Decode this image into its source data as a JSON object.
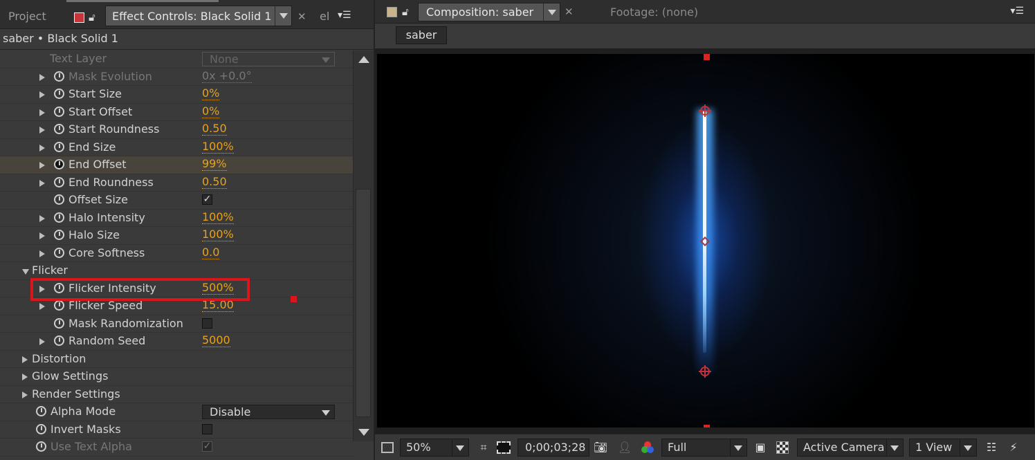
{
  "left_panel": {
    "tab_project": "Project",
    "tab_effect_controls": "Effect Controls: Black Solid 1",
    "tab_overflow": "el",
    "breadcrumb": "saber • Black Solid 1",
    "rows": [
      {
        "name": "Text Layer",
        "type": "dropdown",
        "value": "None",
        "dim": true,
        "indent": 72
      },
      {
        "name": "Mask Evolution",
        "type": "value",
        "value": "0x +0.0°",
        "dim": true,
        "twirl": true,
        "stopwatch": true
      },
      {
        "name": "Start Size",
        "type": "value",
        "value": "0%",
        "twirl": true,
        "stopwatch": true
      },
      {
        "name": "Start Offset",
        "type": "value",
        "value": "0%",
        "twirl": true,
        "stopwatch": true
      },
      {
        "name": "Start Roundness",
        "type": "value",
        "value": "0.50",
        "twirl": true,
        "stopwatch": true
      },
      {
        "name": "End Size",
        "type": "value",
        "value": "100%",
        "twirl": true,
        "stopwatch": true
      },
      {
        "name": "End Offset",
        "type": "value",
        "value": "99%",
        "twirl": true,
        "stopwatch": true,
        "selected": true,
        "active": true
      },
      {
        "name": "End Roundness",
        "type": "value",
        "value": "0.50",
        "twirl": true,
        "stopwatch": true
      },
      {
        "name": "Offset Size",
        "type": "checkbox",
        "checked": true,
        "stopwatch": true
      },
      {
        "name": "Halo Intensity",
        "type": "value",
        "value": "100%",
        "twirl": true,
        "stopwatch": true
      },
      {
        "name": "Halo Size",
        "type": "value",
        "value": "100%",
        "twirl": true,
        "stopwatch": true
      },
      {
        "name": "Core Softness",
        "type": "value",
        "value": "0.0",
        "twirl": true,
        "stopwatch": true
      },
      {
        "name": "Flicker",
        "type": "group",
        "open": true
      },
      {
        "name": "Flicker Intensity",
        "type": "value",
        "value": "500%",
        "twirl": true,
        "stopwatch": true
      },
      {
        "name": "Flicker Speed",
        "type": "value",
        "value": "15.00",
        "twirl": true,
        "stopwatch": true
      },
      {
        "name": "Mask Randomization",
        "type": "checkbox",
        "checked": false,
        "stopwatch": true
      },
      {
        "name": "Random Seed",
        "type": "value",
        "value": "5000",
        "twirl": true,
        "stopwatch": true
      },
      {
        "name": "Distortion",
        "type": "group",
        "open": false
      },
      {
        "name": "Glow Settings",
        "type": "group",
        "open": false
      },
      {
        "name": "Render Settings",
        "type": "group",
        "open": false
      },
      {
        "name": "Alpha Mode",
        "type": "dropdown",
        "value": "Disable",
        "stopwatch": true,
        "level": 1
      },
      {
        "name": "Invert Masks",
        "type": "checkbox",
        "checked": false,
        "stopwatch": true,
        "level": 1
      },
      {
        "name": "Use Text Alpha",
        "type": "checkbox",
        "checked": true,
        "stopwatch": true,
        "level": 1,
        "dim": true
      }
    ]
  },
  "right_panel": {
    "tab_composition": "Composition: saber",
    "tab_footage": "Footage: (none)",
    "comp_button": "saber",
    "toolbar": {
      "zoom": "50%",
      "timecode": "0;00;03;28",
      "resolution": "Full",
      "camera": "Active Camera",
      "views": "1 View"
    }
  },
  "colors": {
    "value_orange": "#e8a21a",
    "highlight_red": "#d9161c",
    "blade_blue": "#3c8cff"
  }
}
